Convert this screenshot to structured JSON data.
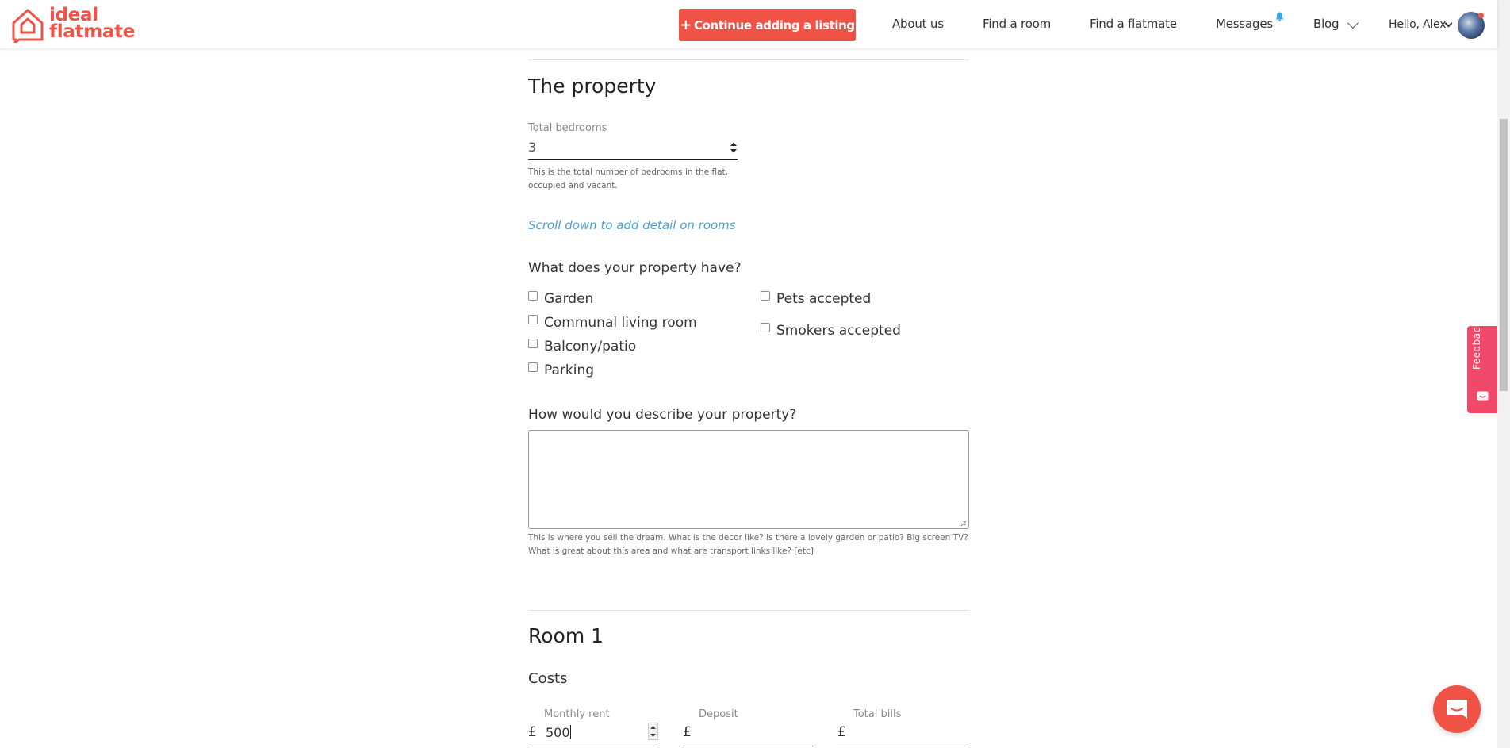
{
  "brand": {
    "logo_line1": "ideal",
    "logo_line2": "flatmate",
    "accent_color": "#f05246"
  },
  "header": {
    "cta_label": "Continue adding a listing",
    "nav": [
      "About us",
      "Find a room",
      "Find a flatmate",
      "Messages",
      "Blog"
    ],
    "user_greeting": "Hello, Alex"
  },
  "property": {
    "heading": "The property",
    "bedrooms_label": "Total bedrooms",
    "bedrooms_value": "3",
    "bedrooms_help": "This is the total number of bedrooms in the flat, occupied and vacant.",
    "scroll_link": "Scroll down to add detail on rooms",
    "features_question": "What does your property have?",
    "features_left": [
      "Garden",
      "Communal living room",
      "Balcony/patio",
      "Parking"
    ],
    "features_right": [
      "Pets accepted",
      "Smokers accepted"
    ],
    "describe_question": "How would you describe your property?",
    "describe_value": "",
    "describe_help": "This is where you sell the dream. What is the decor like? Is there a lovely garden or patio? Big screen TV? What is great about this area and what are transport links like? [etc]"
  },
  "room": {
    "heading": "Room 1",
    "costs_heading": "Costs",
    "currency_symbol": "£",
    "monthly_rent_label": "Monthly rent",
    "monthly_rent_value": "500",
    "deposit_label": "Deposit",
    "deposit_value": "",
    "bills_label": "Total bills",
    "bills_value": ""
  },
  "feedback_label": "Feedback"
}
